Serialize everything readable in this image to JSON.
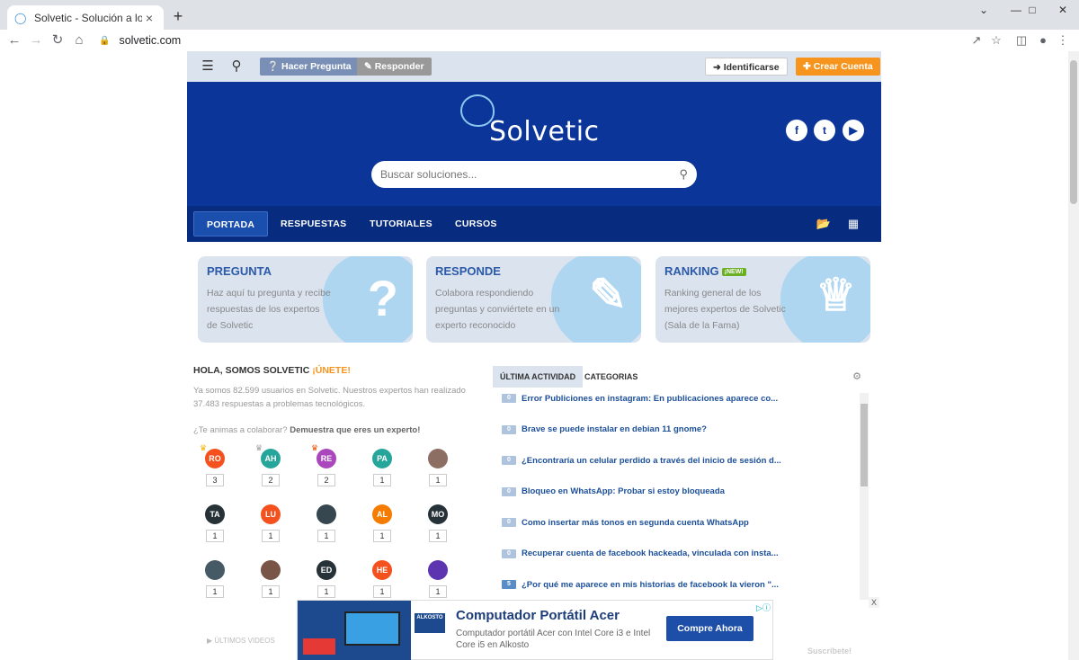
{
  "browser": {
    "tab_title": "Solvetic - Solución a los problem",
    "url": "solvetic.com"
  },
  "topbar": {
    "ask_label": "Hacer Pregunta",
    "answer_label": "Responder",
    "login_label": "Identificarse",
    "register_label": "Crear Cuenta"
  },
  "hero": {
    "logo_text": "olvetic",
    "search_placeholder": "Buscar soluciones..."
  },
  "nav": {
    "items": [
      "PORTADA",
      "RESPUESTAS",
      "TUTORIALES",
      "CURSOS"
    ]
  },
  "cards": [
    {
      "title": "PREGUNTA",
      "text": "Haz aquí tu pregunta y recibe respuestas de los expertos de Solvetic"
    },
    {
      "title": "RESPONDE",
      "text": "Colabora respondiendo preguntas y conviértete en un experto reconocido"
    },
    {
      "title": "RANKING",
      "badge": "¡NEW!",
      "text": "Ranking general de los mejores expertos de Solvetic (Sala de la Fama)"
    }
  ],
  "welcome": {
    "title": "HOLA, SOMOS SOLVETIC",
    "join": "¡ÚNETE!",
    "intro": "Ya somos 82.599 usuarios en Solvetic. Nuestros expertos han realizado 37.483 respuestas a problemas tecnológicos.",
    "collab_q": "¿Te animas a colaborar?",
    "collab_cta": "Demuestra que eres un experto!"
  },
  "users": [
    {
      "initials": "RO",
      "count": "3",
      "color": "#f4511e",
      "trophy": "gold"
    },
    {
      "initials": "AH",
      "count": "2",
      "color": "#26a69a",
      "trophy": "silver"
    },
    {
      "initials": "RE",
      "count": "2",
      "color": "#ab47bc",
      "trophy": "bronze"
    },
    {
      "initials": "PA",
      "count": "1",
      "color": "#26a69a"
    },
    {
      "initials": "",
      "count": "1",
      "color": "#8d6e63"
    },
    {
      "initials": "TA",
      "count": "1",
      "color": "#263238"
    },
    {
      "initials": "LU",
      "count": "1",
      "color": "#f4511e"
    },
    {
      "initials": "",
      "count": "1",
      "color": "#37474f"
    },
    {
      "initials": "AL",
      "count": "1",
      "color": "#f57c00"
    },
    {
      "initials": "MO",
      "count": "1",
      "color": "#263238"
    },
    {
      "initials": "",
      "count": "1",
      "color": "#455a64"
    },
    {
      "initials": "",
      "count": "1",
      "color": "#795548"
    },
    {
      "initials": "ED",
      "count": "1",
      "color": "#263238"
    },
    {
      "initials": "HE",
      "count": "1",
      "color": "#f4511e"
    },
    {
      "initials": "",
      "count": "1",
      "color": "#5e35b1"
    }
  ],
  "videos_label": "ÚLTIMOS VIDEOS",
  "activity_tabs": [
    "ÚLTIMA ACTIVIDAD",
    "CATEGORIAS"
  ],
  "activity": [
    {
      "n": "0",
      "text": "Error Publiciones en instagram: En publicaciones aparece co..."
    },
    {
      "n": "0",
      "text": "Brave se puede instalar en debian 11 gnome?"
    },
    {
      "n": "0",
      "text": "¿Encontraría un celular perdido a través del inicio de sesión d..."
    },
    {
      "n": "0",
      "text": "Bloqueo en WhatsApp: Probar si estoy bloqueada"
    },
    {
      "n": "0",
      "text": "Como insertar más tonos en segunda cuenta WhatsApp"
    },
    {
      "n": "0",
      "text": "Recuperar cuenta de facebook hackeada, vinculada con insta..."
    },
    {
      "n": "5",
      "text": "¿Por qué me aparece en mis historias de facebook la vieron \"..."
    }
  ],
  "subscribe_label": "Suscríbete!",
  "ad": {
    "brand": "ALKOSTO",
    "title": "Computador Portátil Acer",
    "desc": "Computador portátil Acer con Intel Core i3 e Intel Core i5 en Alkosto",
    "cta": "Compre Ahora",
    "close": "X"
  },
  "colors": {
    "hero_bg": "#0c3599",
    "nav_bg": "#072b7e",
    "accent_orange": "#f7941d",
    "card_bg": "#dbe3ef"
  }
}
